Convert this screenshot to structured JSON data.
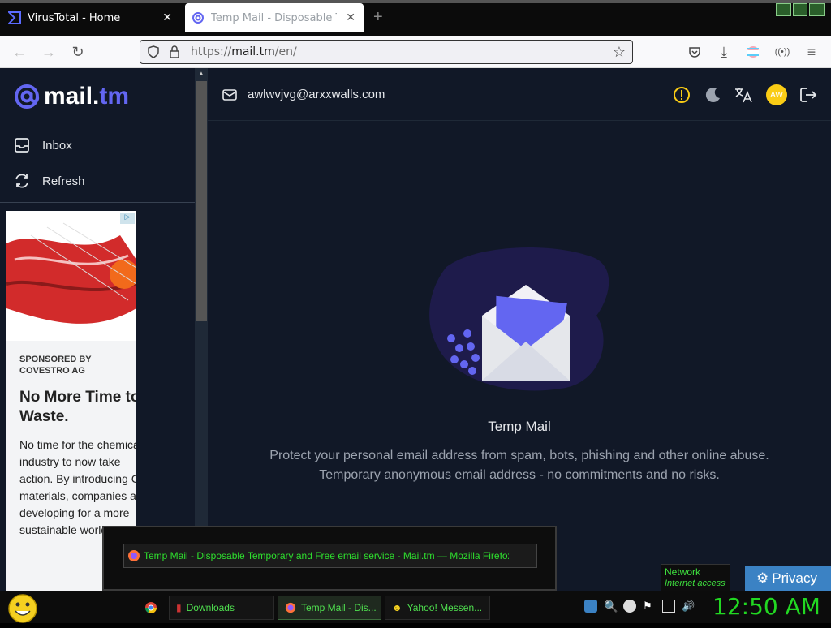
{
  "browser": {
    "tabs": [
      {
        "label": "VirusTotal - Home",
        "active": false
      },
      {
        "label": "Temp Mail - Disposable Temporary",
        "active": true
      }
    ],
    "url_prefix": "https://",
    "url_domain": "mail.tm",
    "url_path": "/en/"
  },
  "app": {
    "logo_main": "mail.",
    "logo_tm": "tm",
    "nav": [
      {
        "label": "Inbox",
        "icon": "inbox-icon"
      },
      {
        "label": "Refresh",
        "icon": "refresh-icon"
      }
    ],
    "email": "awlwvjvg@arxxwalls.com",
    "avatar": "AW",
    "hero_title": "Temp Mail",
    "hero_line1": "Protect your personal email address from spam, bots, phishing and other online abuse.",
    "hero_line2": "Temporary anonymous email address - no commitments and no risks."
  },
  "ad": {
    "sponsor": "SPONSORED BY COVESTRO AG",
    "headline": "No More Time to Waste.",
    "body": "No time for the chemical industry to now take action. By introducing CQ materials, companies are developing for a more sustainable world."
  },
  "overlay": {
    "window_title": "Temp Mail - Disposable Temporary and Free email service - Mail.tm — Mozilla Firefox",
    "network_l1": "Network",
    "network_l2": "Internet access",
    "privacy": "Privacy"
  },
  "taskbar": {
    "tasks": [
      {
        "label": "Downloads"
      },
      {
        "label": "Temp Mail - Dis..."
      },
      {
        "label": "Yahoo! Messen..."
      }
    ],
    "clock": "12:50 AM"
  },
  "colors": {
    "accent": "#6366f1",
    "page_bg": "#111827",
    "taskbar_green": "#22d822",
    "avatar": "#facc15"
  }
}
